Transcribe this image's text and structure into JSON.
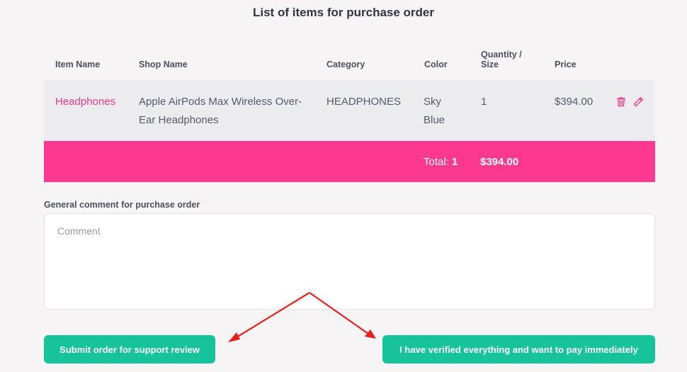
{
  "title": "List of items for purchase order",
  "table": {
    "headers": {
      "item_name": "Item Name",
      "shop_name": "Shop Name",
      "category": "Category",
      "color": "Color",
      "quantity_line1": "Quantity /",
      "quantity_line2": "Size",
      "price": "Price"
    },
    "rows": [
      {
        "item_name": "Headphones",
        "shop_name_line1": "Apple AirPods Max Wireless Over-",
        "shop_name_line2": "Ear Headphones",
        "category": "HEADPHONES",
        "color_line1": "Sky",
        "color_line2": "Blue",
        "quantity": "1",
        "price": "$394.00",
        "actions": [
          "trash-icon",
          "pencil-icon"
        ]
      }
    ],
    "total": {
      "label": "Total:",
      "count": "1",
      "price": "$394.00"
    }
  },
  "comment": {
    "label": "General comment for purchase order",
    "placeholder": "Comment",
    "value": ""
  },
  "buttons": {
    "submit_label": "Submit order for support review",
    "pay_label": "I have verified everything and want to pay immediately"
  },
  "colors": {
    "accent_pink": "#fc3890",
    "item_link": "#f0378a",
    "button_green": "#16c39a",
    "annotation_arrow": "#e8201c"
  }
}
